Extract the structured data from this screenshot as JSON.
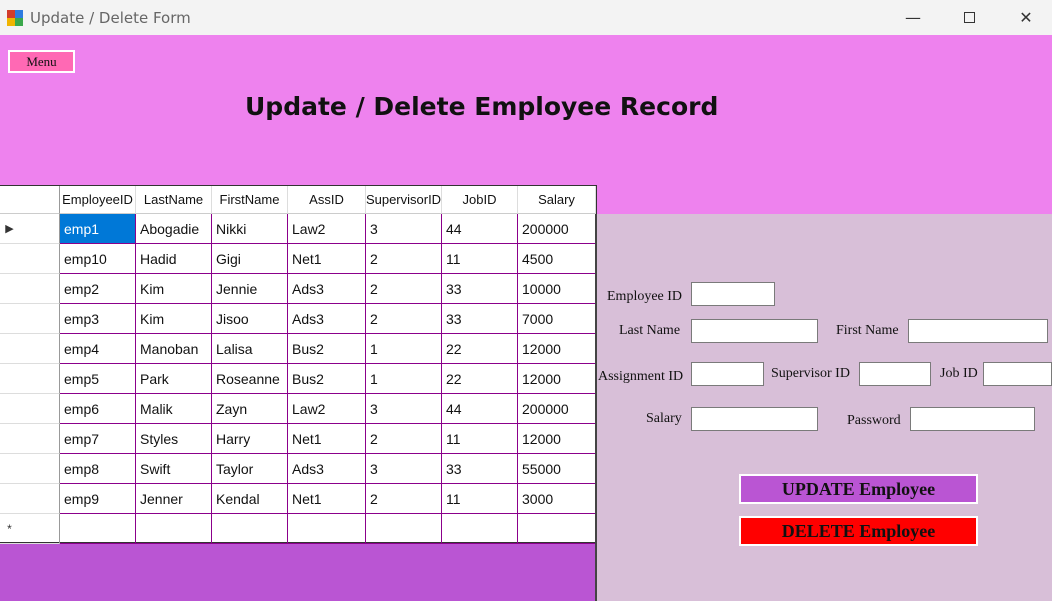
{
  "window": {
    "title": "Update / Delete Form",
    "minimize_glyph": "—",
    "close_glyph": "✕"
  },
  "header": {
    "menu_label": "Menu",
    "title": "Update / Delete Employee Record"
  },
  "grid": {
    "columns": [
      "EmployeeID",
      "LastName",
      "FirstName",
      "AssID",
      "SupervisorID",
      "JobID",
      "Salary"
    ],
    "row_indicator_current": "▶",
    "row_indicator_new": "*",
    "rows": [
      [
        "emp1",
        "Abogadie",
        "Nikki",
        "Law2",
        "3",
        "44",
        "200000"
      ],
      [
        "emp10",
        "Hadid",
        "Gigi",
        "Net1",
        "2",
        "11",
        "4500"
      ],
      [
        "emp2",
        "Kim",
        "Jennie",
        "Ads3",
        "2",
        "33",
        "10000"
      ],
      [
        "emp3",
        "Kim",
        "Jisoo",
        "Ads3",
        "2",
        "33",
        "7000"
      ],
      [
        "emp4",
        "Manoban",
        "Lalisa",
        "Bus2",
        "1",
        "22",
        "12000"
      ],
      [
        "emp5",
        "Park",
        "Roseanne",
        "Bus2",
        "1",
        "22",
        "12000"
      ],
      [
        "emp6",
        "Malik",
        "Zayn",
        "Law2",
        "3",
        "44",
        "200000"
      ],
      [
        "emp7",
        "Styles",
        "Harry",
        "Net1",
        "2",
        "11",
        "12000"
      ],
      [
        "emp8",
        "Swift",
        "Taylor",
        "Ads3",
        "3",
        "33",
        "55000"
      ],
      [
        "emp9",
        "Jenner",
        "Kendal",
        "Net1",
        "2",
        "11",
        "3000"
      ]
    ]
  },
  "form": {
    "employee_id_label": "Employee ID",
    "last_name_label": "Last Name",
    "first_name_label": "First Name",
    "assignment_id_label": "Assignment ID",
    "supervisor_id_label": "Supervisor ID",
    "job_id_label": "Job ID",
    "salary_label": "Salary",
    "password_label": "Password",
    "update_button": "UPDATE Employee",
    "delete_button": "DELETE Employee"
  },
  "colors": {
    "header_bg": "#ee82ee",
    "right_panel_bg": "#d8bfd8",
    "bottom_bar_bg": "#ba55d3",
    "menu_button": "#ff69b4",
    "update_button": "#ba55d3",
    "delete_button": "#ff0000",
    "selected_cell": "#0078d7"
  }
}
